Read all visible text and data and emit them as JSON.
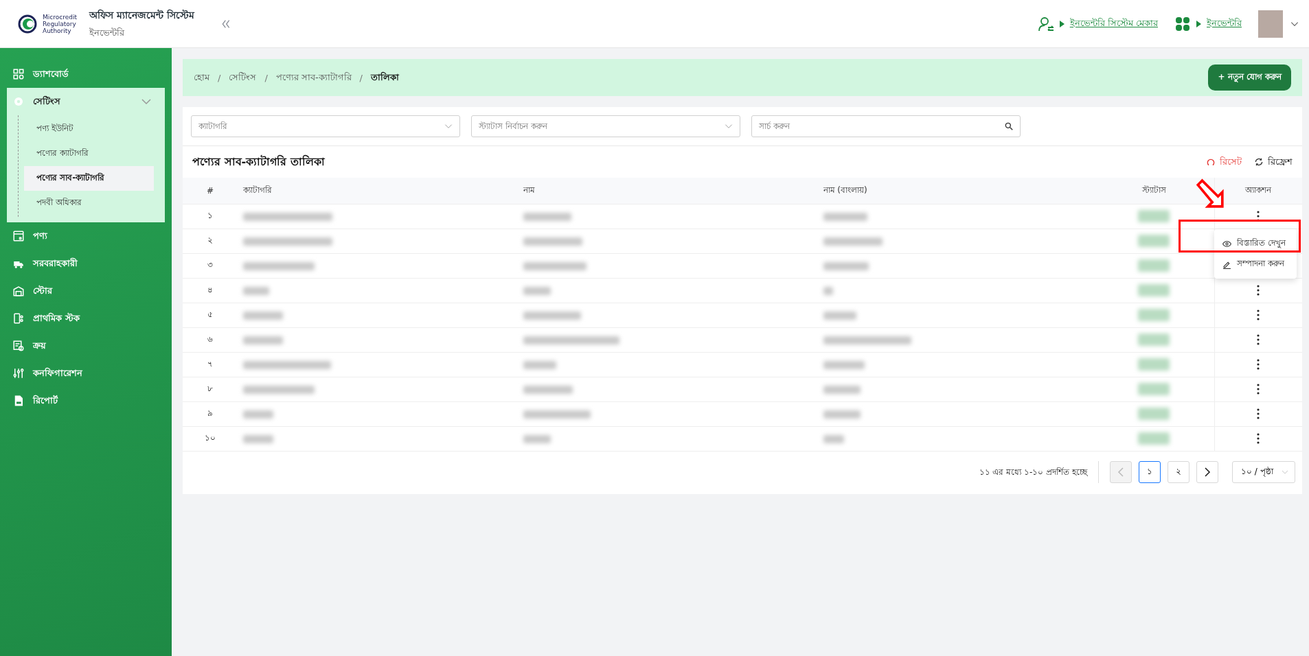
{
  "header": {
    "logo_text": [
      "Microcredit",
      "Regulatory",
      "Authority"
    ],
    "title": "অফিস ম্যানেজমেন্ট সিস্টেম",
    "subtitle": "ইনভেন্টরি",
    "links": [
      {
        "kind": "user-switch",
        "label": "ইনভেন্টরি সিস্টেম মেকার"
      },
      {
        "kind": "apps",
        "label": "ইনভেন্টরি"
      }
    ]
  },
  "sidebar": {
    "items": [
      {
        "kind": "dashboard",
        "label": "ড্যাশবোর্ড",
        "selected": false
      },
      {
        "kind": "gear",
        "label": "সেটিংস",
        "selected": false,
        "expanded": true,
        "children": [
          {
            "label": "পণ্য ইউনিট",
            "selected": false
          },
          {
            "label": "পণ্যের ক্যাটাগরি",
            "selected": false
          },
          {
            "label": "পণ্যের সাব-ক্যাটাগরি",
            "selected": true
          },
          {
            "label": "পদবী অধিকার",
            "selected": false
          }
        ]
      },
      {
        "kind": "box",
        "label": "পণ্য",
        "selected": false
      },
      {
        "kind": "truck",
        "label": "সরবরাহকারী",
        "selected": false
      },
      {
        "kind": "store",
        "label": "স্টোর",
        "selected": false
      },
      {
        "kind": "stock",
        "label": "প্রাথমিক স্টক",
        "selected": false
      },
      {
        "kind": "purchase",
        "label": "ক্রয়",
        "selected": false
      },
      {
        "kind": "sliders",
        "label": "কনফিগারেশন",
        "selected": false
      },
      {
        "kind": "report",
        "label": "রিপোর্ট",
        "selected": false
      }
    ]
  },
  "breadcrumb": {
    "items": [
      "হোম",
      "সেটিংস",
      "পণ্যের সাব-ক্যাটাগরি",
      "তালিকা"
    ],
    "separators": [
      "/",
      "/",
      "/"
    ]
  },
  "add_button": "+ নতুন যোগ করুন",
  "filters": {
    "category": {
      "placeholder": "ক্যাটাগরি"
    },
    "status": {
      "placeholder": "স্ট্যাটাস নির্বাচন করুন"
    },
    "search": {
      "placeholder": "সার্চ করুন"
    }
  },
  "table": {
    "title": "পণ্যের সাব-ক্যাটাগরি তালিকা",
    "reset": "রিসেট",
    "refresh": "রিফ্রেশ",
    "columns": [
      "#",
      "ক্যাটাগরি",
      "নাম",
      "নাম (বাংলায়)",
      "স্ট্যাটাস",
      "অ্যাকশন"
    ],
    "rows": [
      {
        "number": "১"
      },
      {
        "number": "২"
      },
      {
        "number": "৩"
      },
      {
        "number": "৪"
      },
      {
        "number": "৫"
      },
      {
        "number": "৬"
      },
      {
        "number": "৭"
      },
      {
        "number": "৮"
      },
      {
        "number": "৯"
      },
      {
        "number": "১০"
      }
    ],
    "action_menu": {
      "items": [
        {
          "kind": "view",
          "label": "বিস্তারিত দেখুন"
        },
        {
          "kind": "edit",
          "label": "সম্পাদনা করুন"
        }
      ]
    }
  },
  "pagination": {
    "summary": "১১ এর মধ্যে ১-১০ প্রদর্শিত হচ্ছে",
    "pages": [
      {
        "label": "১",
        "selected": true
      },
      {
        "label": "২",
        "selected": false
      }
    ],
    "page_size": "১০ / পৃষ্ঠা"
  }
}
